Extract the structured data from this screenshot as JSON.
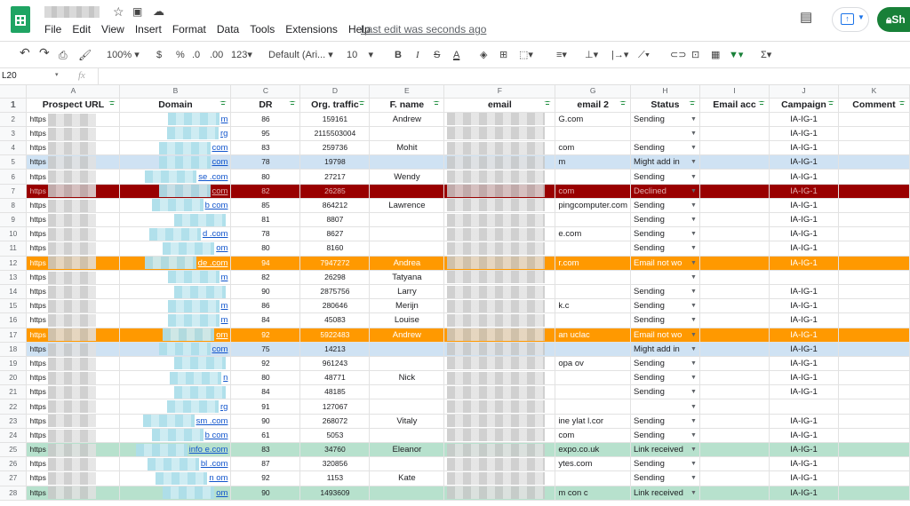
{
  "app": {
    "menu": [
      "File",
      "Edit",
      "View",
      "Insert",
      "Format",
      "Data",
      "Tools",
      "Extensions",
      "Help"
    ],
    "last_edit": "Last edit was seconds ago",
    "share_label": "Sh"
  },
  "toolbar": {
    "zoom": "100%",
    "currency": "$",
    "percent": "%",
    "dec_less": ".0",
    "dec_more": ".00",
    "more_formats": "123",
    "font": "Default (Ari...",
    "font_size": "10"
  },
  "formula_bar": {
    "cell_ref": "L20",
    "fx": "fx",
    "value": ""
  },
  "columns": [
    "A",
    "B",
    "C",
    "D",
    "E",
    "F",
    "G",
    "H",
    "I",
    "J",
    "K"
  ],
  "headers": [
    "Prospect URL",
    "Domain",
    "DR",
    "Org. traffic",
    "F. name",
    "email",
    "email 2",
    "Status",
    "Email acc",
    "Campaign",
    "Comment"
  ],
  "colors": {
    "blue_row": "#cfe2f3",
    "red_row": "#990000",
    "orange_row": "#ff9900",
    "green_row": "#b7e1cd",
    "link": "#1155cc"
  },
  "rows": [
    {
      "n": "2",
      "url": "https",
      "dom": "m",
      "dr": "86",
      "traffic": "159161",
      "fname": "Andrew",
      "email2": "G.com",
      "status": "Sending",
      "campaign": "IA-IG-1",
      "style": ""
    },
    {
      "n": "3",
      "url": "https",
      "dom": "rg",
      "dr": "95",
      "traffic": "2115503004",
      "fname": "",
      "email2": "",
      "status": "",
      "campaign": "IA-IG-1",
      "style": ""
    },
    {
      "n": "4",
      "url": "https",
      "dom": "com",
      "dr": "83",
      "traffic": "259736",
      "fname": "Mohit",
      "email2": "com",
      "status": "Sending",
      "campaign": "IA-IG-1",
      "style": ""
    },
    {
      "n": "5",
      "url": "https",
      "dom": "com",
      "dr": "78",
      "traffic": "19798",
      "fname": "",
      "email2": "m",
      "status": "Might add in",
      "campaign": "IA-IG-1",
      "style": "r-blue"
    },
    {
      "n": "6",
      "url": "https",
      "dom": "se .com",
      "dr": "80",
      "traffic": "27217",
      "fname": "Wendy",
      "email2": "",
      "status": "Sending",
      "campaign": "IA-IG-1",
      "style": ""
    },
    {
      "n": "7",
      "url": "https",
      "dom": "com",
      "dr": "82",
      "traffic": "26285",
      "fname": "",
      "email2": "com",
      "status": "Declined",
      "campaign": "IA-IG-1",
      "style": "r-red"
    },
    {
      "n": "8",
      "url": "https",
      "dom": "b com",
      "dr": "85",
      "traffic": "864212",
      "fname": "Lawrence",
      "email2": "pingcomputer.com",
      "status": "Sending",
      "campaign": "IA-IG-1",
      "style": ""
    },
    {
      "n": "9",
      "url": "https",
      "dom": "",
      "dr": "81",
      "traffic": "8807",
      "fname": "",
      "email2": "",
      "status": "Sending",
      "campaign": "IA-IG-1",
      "style": ""
    },
    {
      "n": "10",
      "url": "https",
      "dom": "d .com",
      "dr": "78",
      "traffic": "8627",
      "fname": "",
      "email2": "e.com",
      "status": "Sending",
      "campaign": "IA-IG-1",
      "style": ""
    },
    {
      "n": "11",
      "url": "https",
      "dom": "om",
      "dr": "80",
      "traffic": "8160",
      "fname": "",
      "email2": "",
      "status": "Sending",
      "campaign": "IA-IG-1",
      "style": ""
    },
    {
      "n": "12",
      "url": "https",
      "dom": "de .com",
      "dr": "94",
      "traffic": "7947272",
      "fname": "Andrea",
      "email2": "r.com",
      "status": "Email not wo",
      "campaign": "IA-IG-1",
      "style": "r-orange"
    },
    {
      "n": "13",
      "url": "https",
      "dom": "m",
      "dr": "82",
      "traffic": "26298",
      "fname": "Tatyana",
      "email2": "",
      "status": "",
      "campaign": "",
      "style": ""
    },
    {
      "n": "14",
      "url": "https",
      "dom": "",
      "dr": "90",
      "traffic": "2875756",
      "fname": "Larry",
      "email2": "",
      "status": "Sending",
      "campaign": "IA-IG-1",
      "style": ""
    },
    {
      "n": "15",
      "url": "https",
      "dom": "m",
      "dr": "86",
      "traffic": "280646",
      "fname": "Merijn",
      "email2": "k.c",
      "status": "Sending",
      "campaign": "IA-IG-1",
      "style": ""
    },
    {
      "n": "16",
      "url": "https",
      "dom": "m",
      "dr": "84",
      "traffic": "45083",
      "fname": "Louise",
      "email2": "",
      "status": "Sending",
      "campaign": "IA-IG-1",
      "style": ""
    },
    {
      "n": "17",
      "url": "https",
      "dom": "om",
      "dr": "92",
      "traffic": "5922483",
      "fname": "Andrew",
      "email2": "an uclac",
      "status": "Email not wo",
      "campaign": "IA-IG-1",
      "style": "r-orange"
    },
    {
      "n": "18",
      "url": "https",
      "dom": "com",
      "dr": "75",
      "traffic": "14213",
      "fname": "",
      "email2": "",
      "status": "Might add in",
      "campaign": "IA-IG-1",
      "style": "r-blue"
    },
    {
      "n": "19",
      "url": "https",
      "dom": "",
      "dr": "92",
      "traffic": "961243",
      "fname": "",
      "email2": "opa ov",
      "status": "Sending",
      "campaign": "IA-IG-1",
      "style": ""
    },
    {
      "n": "20",
      "url": "https",
      "dom": "n",
      "dr": "80",
      "traffic": "48771",
      "fname": "Nick",
      "email2": "",
      "status": "Sending",
      "campaign": "IA-IG-1",
      "style": ""
    },
    {
      "n": "21",
      "url": "https",
      "dom": "",
      "dr": "84",
      "traffic": "48185",
      "fname": "",
      "email2": "",
      "status": "Sending",
      "campaign": "IA-IG-1",
      "style": ""
    },
    {
      "n": "22",
      "url": "https",
      "dom": "rg",
      "dr": "91",
      "traffic": "127067",
      "fname": "",
      "email2": "",
      "status": "",
      "campaign": "",
      "style": ""
    },
    {
      "n": "23",
      "url": "https",
      "dom": "sm .com",
      "dr": "90",
      "traffic": "268072",
      "fname": "Vitaly",
      "email2": "ine ylat l.cor",
      "status": "Sending",
      "campaign": "IA-IG-1",
      "style": ""
    },
    {
      "n": "24",
      "url": "https",
      "dom": "b com",
      "dr": "61",
      "traffic": "5053",
      "fname": "",
      "email2": "com",
      "status": "Sending",
      "campaign": "IA-IG-1",
      "style": ""
    },
    {
      "n": "25",
      "url": "https",
      "dom": "info e.com",
      "dr": "83",
      "traffic": "34760",
      "fname": "Eleanor",
      "email2": "expo.co.uk",
      "status": "Link received",
      "campaign": "IA-IG-1",
      "style": "r-green"
    },
    {
      "n": "26",
      "url": "https",
      "dom": "bl .com",
      "dr": "87",
      "traffic": "320856",
      "fname": "",
      "email2": "ytes.com",
      "status": "Sending",
      "campaign": "IA-IG-1",
      "style": ""
    },
    {
      "n": "27",
      "url": "https",
      "dom": "n om",
      "dr": "92",
      "traffic": "1153",
      "fname": "Kate",
      "email2": "",
      "status": "Sending",
      "campaign": "IA-IG-1",
      "style": ""
    },
    {
      "n": "28",
      "url": "https",
      "dom": "om",
      "dr": "90",
      "traffic": "1493609",
      "fname": "",
      "email2": "m con c",
      "status": "Link received",
      "campaign": "IA-IG-1",
      "style": "r-green"
    }
  ]
}
